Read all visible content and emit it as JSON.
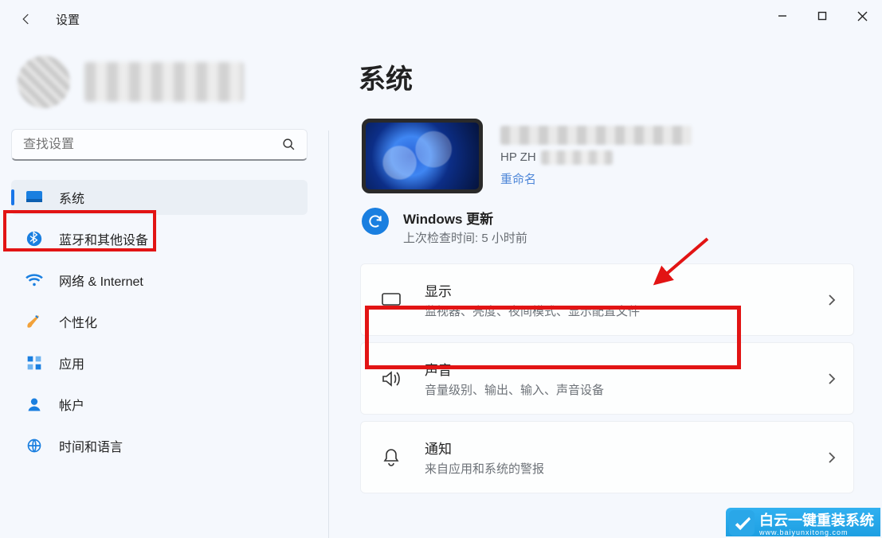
{
  "window": {
    "title": "设置"
  },
  "search": {
    "placeholder": "查找设置"
  },
  "sidebar": {
    "items": [
      {
        "label": "系统"
      },
      {
        "label": "蓝牙和其他设备"
      },
      {
        "label": "网络 & Internet"
      },
      {
        "label": "个性化"
      },
      {
        "label": "应用"
      },
      {
        "label": "帐户"
      },
      {
        "label": "时间和语言"
      }
    ]
  },
  "page": {
    "title": "系统"
  },
  "device": {
    "model_prefix": "HP ZH",
    "rename": "重命名"
  },
  "update": {
    "title": "Windows 更新",
    "subtitle": "上次检查时间: 5 小时前"
  },
  "cards": [
    {
      "title": "显示",
      "subtitle": "监视器、亮度、夜间模式、显示配置文件"
    },
    {
      "title": "声音",
      "subtitle": "音量级别、输出、输入、声音设备"
    },
    {
      "title": "通知",
      "subtitle": "来自应用和系统的警报"
    }
  ],
  "watermark": {
    "line1": "白云一键重装系统",
    "line2": "www.baiyunxitong.com"
  }
}
